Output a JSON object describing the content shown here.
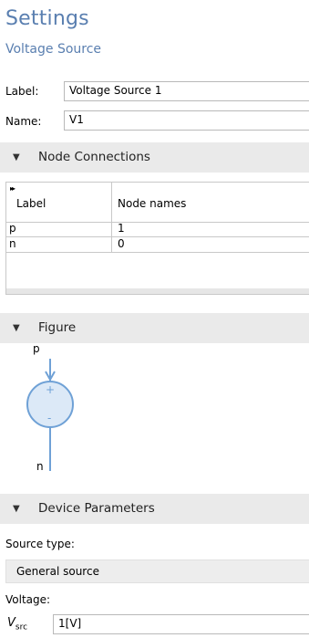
{
  "header": {
    "title": "Settings",
    "subtitle": "Voltage Source"
  },
  "fields": {
    "label": {
      "caption": "Label:",
      "value": "Voltage Source 1"
    },
    "name": {
      "caption": "Name:",
      "value": "V1"
    }
  },
  "sections": {
    "node_connections": "Node Connections",
    "figure": "Figure",
    "device_parameters": "Device Parameters"
  },
  "table": {
    "expand_glyph": "▸▸",
    "headers": [
      "Label",
      "Node names"
    ],
    "rows": [
      {
        "label": "p",
        "node": "1"
      },
      {
        "label": "n",
        "node": "0"
      }
    ]
  },
  "figure": {
    "top_node": "p",
    "bottom_node": "n",
    "plus": "+",
    "minus": "-",
    "colors": {
      "stroke": "#6fa1d6",
      "fill": "#dce9f7"
    }
  },
  "device": {
    "source_type_caption": "Source type:",
    "source_type_value": "General source",
    "voltage_caption": "Voltage:",
    "vsrc_symbol": "V",
    "vsrc_sub": "src",
    "vsrc_value": "1[V]"
  }
}
